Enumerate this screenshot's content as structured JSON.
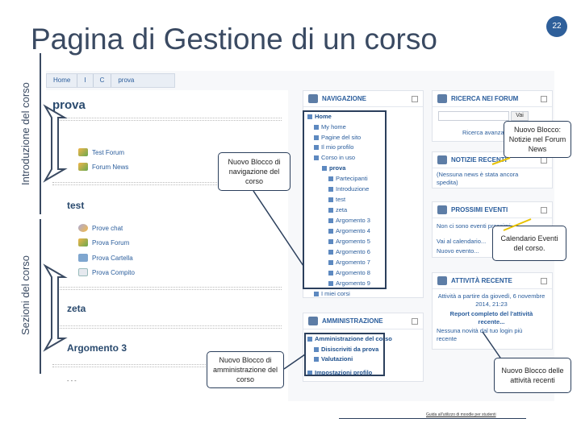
{
  "slide": {
    "title": "Pagina di Gestione di un corso",
    "page_number": "22",
    "label_intro": "Introduzione del corso",
    "label_sections": "Sezioni del corso",
    "footer": "Guida all'utilizzo di moodle per studenti"
  },
  "breadcrumb": [
    "Home",
    "I",
    "C",
    "prova"
  ],
  "course": {
    "title": "prova",
    "intro_activities": [
      "Test Forum",
      "Forum News"
    ],
    "section_test": "test",
    "test_activities": [
      "Prove chat",
      "Prova Forum",
      "Prova Cartella",
      "Prova Compito"
    ],
    "section_zeta": "zeta",
    "section_arg3": "Argomento 3",
    "bottom_partial": "-     -   -"
  },
  "navigation": {
    "header": "NAVIGAZIONE",
    "items": [
      "Home",
      "My home",
      "Pagine del sito",
      "Il mio profilo",
      "Corso in uso",
      "prova",
      "Partecipanti",
      "Introduzione",
      "test",
      "zeta",
      "Argomento 3",
      "Argomento 4",
      "Argomento 5",
      "Argomento 6",
      "Argomento 7",
      "Argomento 8",
      "Argomento 9",
      "I miei corsi"
    ]
  },
  "administration": {
    "header": "AMMINISTRAZIONE",
    "items": [
      "Amministrazione del corso",
      "Disiscriviti da prova",
      "Valutazioni",
      "Impostazioni profilo"
    ]
  },
  "forum_search": {
    "header": "RICERCA NEI FORUM",
    "button": "Vai",
    "advanced": "Ricerca avanzata"
  },
  "news": {
    "header": "NOTIZIE RECENTI",
    "text": "(Nessuna news è stata ancora spedita)"
  },
  "events": {
    "header": "PROSSIMI EVENTI",
    "none": "Non ci sono eventi prossimi",
    "calendar": "Vai al calendario...",
    "new_event": "Nuovo evento..."
  },
  "recent_activity": {
    "header": "ATTIVITÀ RECENTE",
    "since": "Attività a partire da giovedì, 6 novembre 2014, 21:23",
    "report": "Report completo del l'attività recente...",
    "none": "Nessuna novità dal tuo login più recente"
  },
  "callouts": {
    "nav_block": "Nuovo Blocco di navigazione del corso",
    "forum_news": "Nuovo Blocco: Notizie nel Forum News",
    "calendar": "Calendario Eventi del corso.",
    "admin_block": "Nuovo Blocco di amministrazione del corso",
    "recent_block": "Nuovo Blocco delle attività recenti"
  },
  "colors": {
    "title": "#3a4a62",
    "accent": "#2e5f9a",
    "link": "#2a5d9c"
  }
}
